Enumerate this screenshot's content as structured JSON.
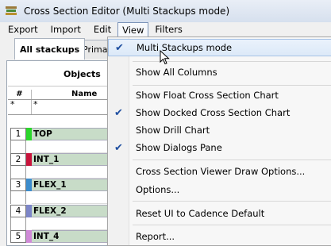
{
  "window": {
    "title": "Cross Section Editor (Multi Stackups mode)"
  },
  "menubar": {
    "items": [
      "Export",
      "Import",
      "Edit",
      "View",
      "Filters"
    ]
  },
  "tabs": [
    "All stackups",
    "Primary"
  ],
  "table": {
    "objects_header": "Objects",
    "num_header": "#",
    "name_header": "Name",
    "filter_num": "*",
    "filter_name": "*",
    "layers": [
      {
        "num": "1",
        "name": "TOP",
        "color": "#2bd62b"
      },
      {
        "num": "2",
        "name": "INT_1",
        "color": "#c8143c"
      },
      {
        "num": "3",
        "name": "FLEX_1",
        "color": "#3c8ccc"
      },
      {
        "num": "4",
        "name": "FLEX_2",
        "color": "#7d86c8"
      },
      {
        "num": "5",
        "name": "INT_4",
        "color": "#d08ad8"
      }
    ]
  },
  "view_menu": {
    "items": [
      {
        "label": "Multi Stackups mode",
        "checked": true
      },
      {
        "label": "Show All Columns",
        "checked": false
      },
      {
        "label": "Show Float Cross Section Chart",
        "checked": false
      },
      {
        "label": "Show Docked Cross Section Chart",
        "checked": true
      },
      {
        "label": "Show Drill Chart",
        "checked": false
      },
      {
        "label": "Show Dialogs Pane",
        "checked": true
      },
      {
        "label": "Cross Section Viewer Draw Options...",
        "checked": false
      },
      {
        "label": "Options...",
        "checked": false
      },
      {
        "label": "Reset UI to Cadence Default",
        "checked": false
      },
      {
        "label": "Report...",
        "checked": false
      }
    ],
    "check_glyph": "✔"
  }
}
